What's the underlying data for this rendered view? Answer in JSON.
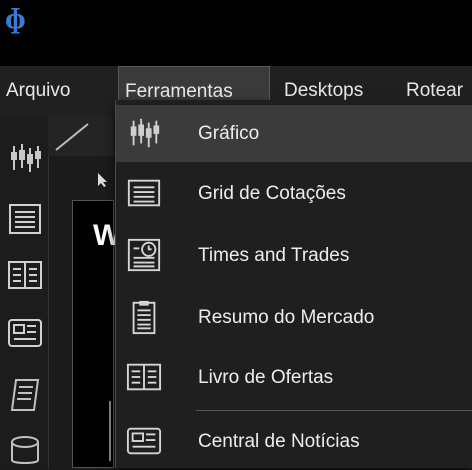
{
  "app": {
    "logo_glyph": "ɸ"
  },
  "menubar": {
    "items": [
      {
        "label": "Arquivo"
      },
      {
        "label": "Ferramentas"
      },
      {
        "label": "Desktops"
      },
      {
        "label": "Rotear"
      }
    ]
  },
  "chart_panel": {
    "title_fragment": "W"
  },
  "dropdown": {
    "items": [
      {
        "label": "Gráfico",
        "icon": "candlestick-chart-icon"
      },
      {
        "label": "Grid de Cotações",
        "icon": "grid-lines-icon"
      },
      {
        "label": "Times and Trades",
        "icon": "clock-list-icon"
      },
      {
        "label": "Resumo do Mercado",
        "icon": "clipboard-icon"
      },
      {
        "label": "Livro de Ofertas",
        "icon": "open-book-icon"
      },
      {
        "label": "Central de Notícias",
        "icon": "newspaper-icon"
      }
    ]
  },
  "colors": {
    "menu_hover": "#3b3b3b",
    "background": "#1b1b1b",
    "titlebar": "#000000"
  }
}
